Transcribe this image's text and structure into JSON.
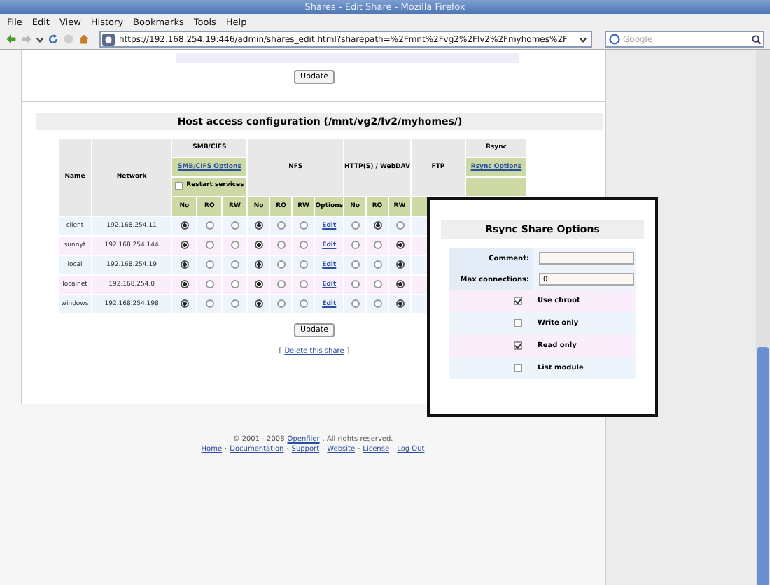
{
  "window": {
    "title": "Shares - Edit Share - Mozilla Firefox"
  },
  "menu": [
    "File",
    "Edit",
    "View",
    "History",
    "Bookmarks",
    "Tools",
    "Help"
  ],
  "address_bar": {
    "url": "https://192.168.254.19:446/admin/shares_edit.html?sharepath=%2Fmnt%2Fvg2%2Flv2%2Fmyhomes%2F"
  },
  "search": {
    "placeholder": "Google"
  },
  "top_section": {
    "button": "Update"
  },
  "host_access": {
    "title": "Host access configuration (/mnt/vg2/lv2/myhomes/)",
    "headers": {
      "name": "Name",
      "network": "Network",
      "smb": "SMB/CIFS",
      "smb_options": "SMB/CIFS Options",
      "restart_services": {
        "label": "Restart services",
        "checked": false
      },
      "nfs": "NFS",
      "http": "HTTP(S) / WebDAV",
      "ftp": "FTP",
      "rsync": "Rsync",
      "rsync_options": "Rsync Options"
    },
    "subheaders": {
      "smb": [
        "No",
        "RO",
        "RW"
      ],
      "nfs": [
        "No",
        "RO",
        "RW",
        "Options"
      ],
      "http": [
        "No",
        "RO",
        "RW"
      ]
    },
    "rows": [
      {
        "name": "client",
        "network": "192.168.254.11",
        "smb": [
          {
            "selected": true
          },
          {
            "selected": false
          },
          {
            "selected": false
          }
        ],
        "nfs": [
          {
            "selected": true
          },
          {
            "selected": false
          },
          {
            "selected": false
          }
        ],
        "nfs_options": "Edit",
        "http": [
          {
            "selected": false
          },
          {
            "selected": true
          },
          {
            "selected": false
          }
        ]
      },
      {
        "name": "sunnyt",
        "network": "192.168.254.144",
        "smb": [
          {
            "selected": true
          },
          {
            "selected": false
          },
          {
            "selected": false
          }
        ],
        "nfs": [
          {
            "selected": true
          },
          {
            "selected": false
          },
          {
            "selected": false
          }
        ],
        "nfs_options": "Edit",
        "http": [
          {
            "selected": false
          },
          {
            "selected": false
          },
          {
            "selected": true
          }
        ]
      },
      {
        "name": "local",
        "network": "192.168.254.19",
        "smb": [
          {
            "selected": true
          },
          {
            "selected": false
          },
          {
            "selected": false
          }
        ],
        "nfs": [
          {
            "selected": true
          },
          {
            "selected": false
          },
          {
            "selected": false
          }
        ],
        "nfs_options": "Edit",
        "http": [
          {
            "selected": false
          },
          {
            "selected": false
          },
          {
            "selected": true
          }
        ]
      },
      {
        "name": "localnet",
        "network": "192.168.254.0",
        "smb": [
          {
            "selected": true
          },
          {
            "selected": false
          },
          {
            "selected": false
          }
        ],
        "nfs": [
          {
            "selected": true
          },
          {
            "selected": false
          },
          {
            "selected": false
          }
        ],
        "nfs_options": "Edit",
        "http": [
          {
            "selected": false
          },
          {
            "selected": false
          },
          {
            "selected": true
          }
        ]
      },
      {
        "name": "windows",
        "network": "192.168.254.198",
        "smb": [
          {
            "selected": true
          },
          {
            "selected": false
          },
          {
            "selected": false
          }
        ],
        "nfs": [
          {
            "selected": true
          },
          {
            "selected": false
          },
          {
            "selected": false
          }
        ],
        "nfs_options": "Edit",
        "http": [
          {
            "selected": false
          },
          {
            "selected": false
          },
          {
            "selected": true
          }
        ]
      }
    ],
    "button": "Update",
    "delete_link": {
      "before": "[",
      "label": "Delete this share",
      "after": "]"
    }
  },
  "popup": {
    "title": "Rsync Share Options",
    "fields": [
      {
        "label": "Comment:"
      },
      {
        "label": "Max connections:",
        "value": "0"
      }
    ],
    "options": [
      {
        "label": "Use chroot",
        "checked": true
      },
      {
        "label": "Write only",
        "checked": false
      },
      {
        "label": "Read only",
        "checked": true
      },
      {
        "label": "List module",
        "checked": false
      }
    ]
  },
  "footer": {
    "copyright": "© 2001 - 2008",
    "company": "Openfiler",
    "rights": ". All rights reserved.",
    "links": [
      "Home",
      "Documentation",
      "Support",
      "Website",
      "License",
      "Log Out"
    ],
    "separators": [
      "·",
      "·",
      "·",
      "·",
      "·"
    ]
  }
}
